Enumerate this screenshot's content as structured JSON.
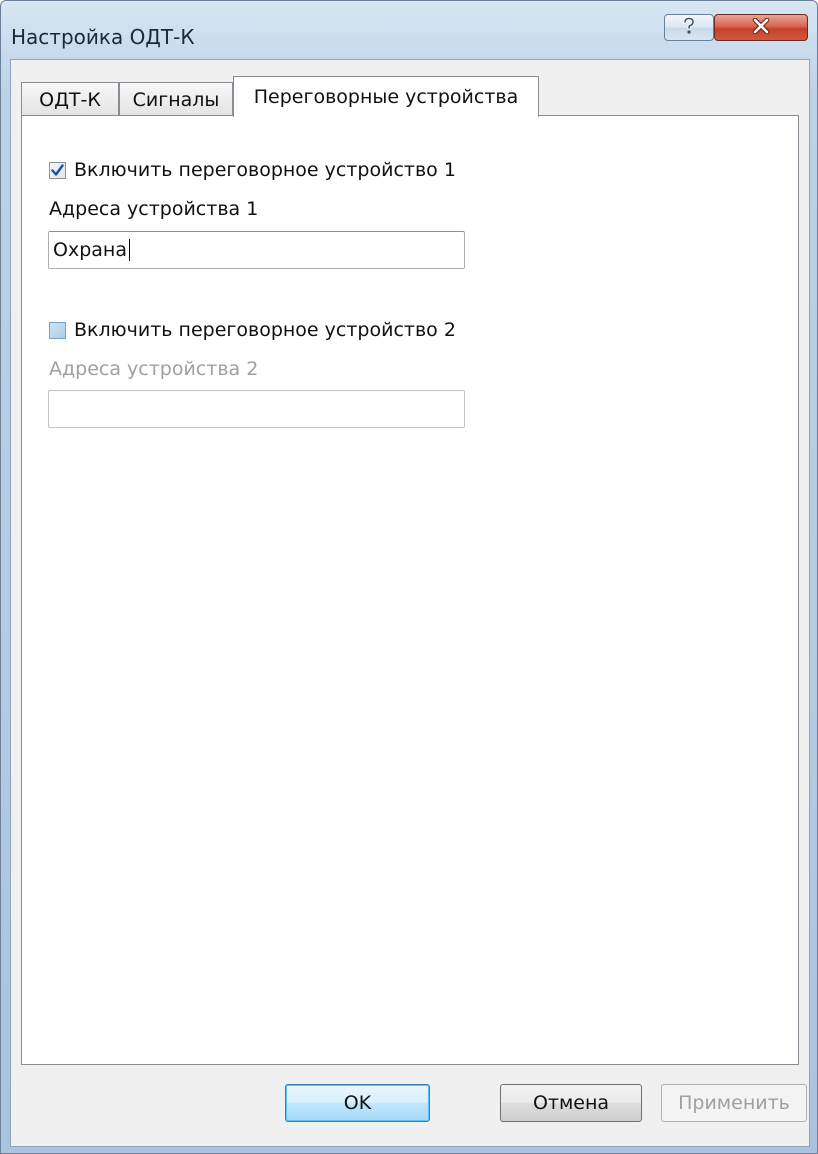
{
  "window": {
    "title": "Настройка ОДТ-К",
    "help_icon": "question-mark-icon",
    "close_icon": "close-x-icon"
  },
  "tabs": [
    {
      "label": "ОДТ-К",
      "active": false
    },
    {
      "label": "Сигналы",
      "active": false
    },
    {
      "label": "Переговорные устройства",
      "active": true
    }
  ],
  "intercom1": {
    "checkbox_label": "Включить переговорное устройство 1",
    "checked": true,
    "address_label": "Адреса устройства 1",
    "address_value": "Охрана"
  },
  "intercom2": {
    "checkbox_label": "Включить переговорное устройство 2",
    "checked": false,
    "address_label": "Адреса устройства 2",
    "address_value": ""
  },
  "buttons": {
    "ok": "OK",
    "cancel": "Отмена",
    "apply": "Применить"
  },
  "colors": {
    "titlebar": "#b9cfe6",
    "close_button": "#c4402a",
    "checkbox_checked_mark": "#1c4fa0",
    "default_button": "#bee6fd",
    "disabled_text": "#a0a0a0"
  }
}
